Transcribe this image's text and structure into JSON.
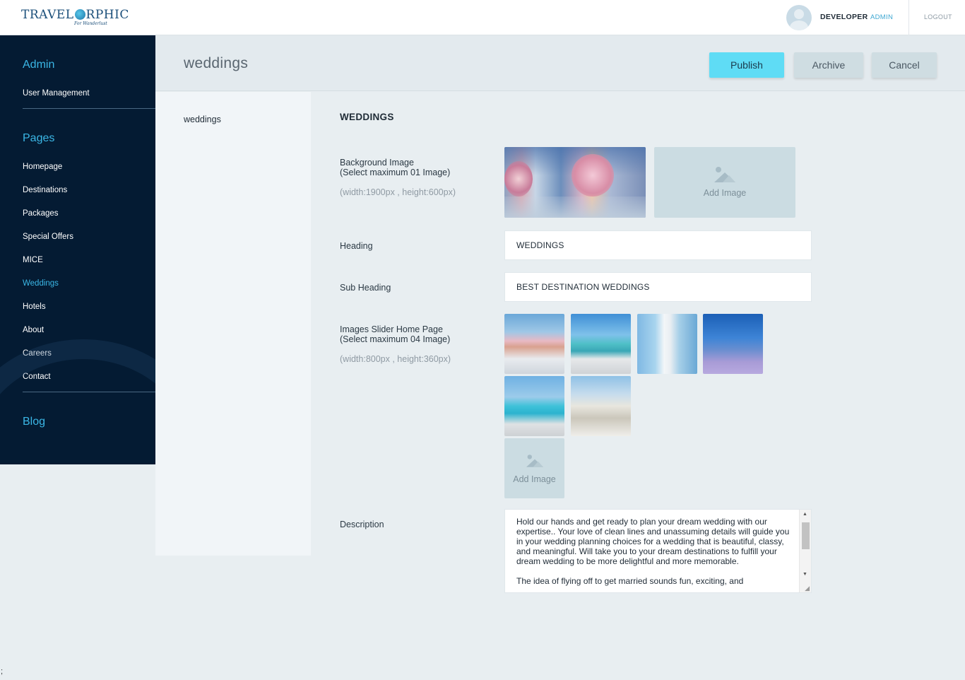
{
  "topbar": {
    "logo_text_a": "TRAVEL",
    "logo_text_b": "RPHIC",
    "logo_tagline": "For Wanderlust",
    "user_name": "DEVELOPER",
    "user_role": "ADMIN",
    "logout_label": "LOGOUT"
  },
  "sidebar": {
    "admin_title": "Admin",
    "admin_items": [
      "User Management"
    ],
    "pages_title": "Pages",
    "pages_items": [
      "Homepage",
      "Destinations",
      "Packages",
      "Special Offers",
      "MICE",
      "Weddings",
      "Hotels",
      "About",
      "Careers",
      "Contact"
    ],
    "active_item": "Weddings",
    "blog_title": "Blog"
  },
  "header": {
    "page_title": "weddings",
    "publish_label": "Publish",
    "archive_label": "Archive",
    "cancel_label": "Cancel"
  },
  "subnav": {
    "items": [
      "weddings"
    ]
  },
  "form": {
    "title": "WEDDINGS",
    "background_label_line1": "Background Image",
    "background_label_line2": "(Select maximum 01 Image)",
    "background_hint": "(width:1900px , height:600px)",
    "add_image_label": "Add Image",
    "heading_label": "Heading",
    "heading_value": "WEDDINGS",
    "subheading_label": "Sub Heading",
    "subheading_value": "BEST DESTINATION WEDDINGS",
    "slider_label_line1": "Images Slider Home Page",
    "slider_label_line2": "(Select maximum 04 Image)",
    "slider_hint": "(width:800px , height:360px)",
    "description_label": "Description",
    "description_value": "Hold our hands and get ready to plan your dream wedding with our expertise.. Your love of clean lines and unassuming details will guide you in your wedding planning choices for a wedding that is beautiful, classy, and meaningful. Will take you to your dream destinations to fulfill your dream wedding to be more delightful and more memorable.\n\nThe idea of flying off to get married sounds fun, exciting, and"
  },
  "footer": {
    "stray_char": ";"
  },
  "colors": {
    "sidebar_bg": "#041b33",
    "accent": "#3bb7e6",
    "publish_bg": "#5fdcf5",
    "secondary_btn_bg": "#cfdde2",
    "page_bg": "#e8eef1"
  },
  "icons": {
    "avatar": "user-avatar-icon",
    "add_image": "image-placeholder-icon"
  }
}
